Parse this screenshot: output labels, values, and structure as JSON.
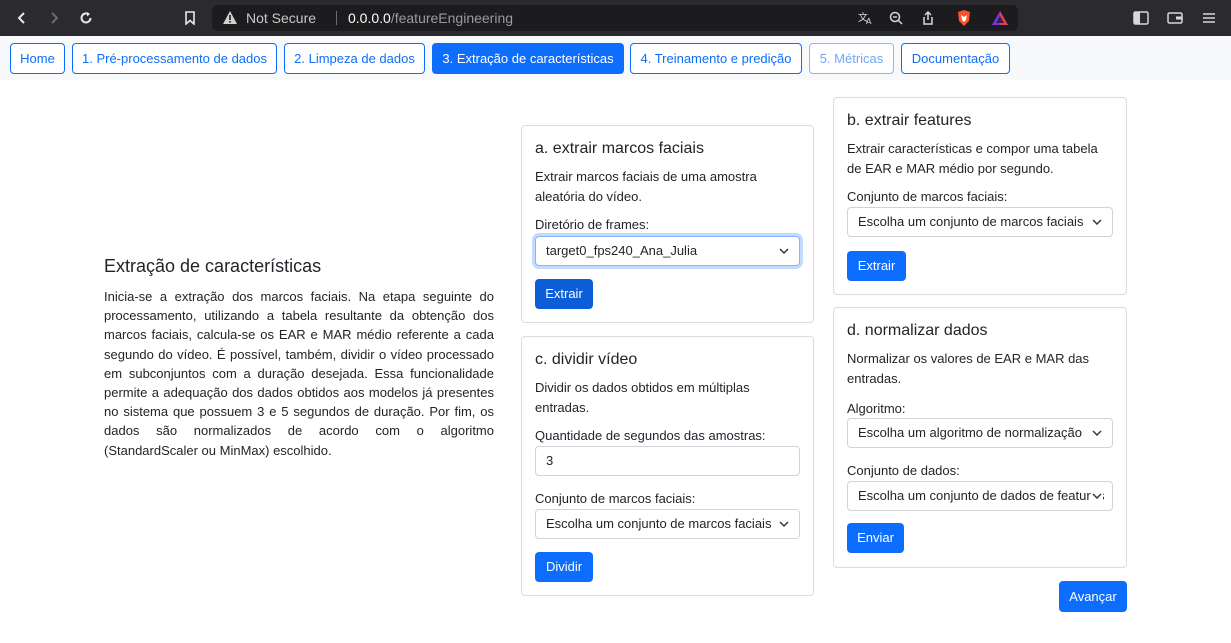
{
  "browser": {
    "security_label": "Not Secure",
    "url_host": "0.0.0.0",
    "url_path": "/featureEngineering"
  },
  "nav": {
    "items": [
      {
        "label": "Home"
      },
      {
        "label": "1. Pré-processamento de dados"
      },
      {
        "label": "2. Limpeza de dados"
      },
      {
        "label": "3. Extração de características"
      },
      {
        "label": "4. Treinamento e predição"
      },
      {
        "label": "5. Métricas"
      },
      {
        "label": "Documentação"
      }
    ],
    "active_index": 3,
    "disabled_index": 5
  },
  "intro": {
    "title": "Extração de características",
    "text": "Inicia-se a extração dos marcos faciais. Na etapa seguinte do processamento, utilizando a tabela resultante da obtenção dos marcos faciais, calcula-se os EAR e MAR médio referente a cada segundo do vídeo. É possível, também, dividir o vídeo processado em subconjuntos com a duração desejada. Essa funcionalidade permite a adequação dos dados obtidos aos modelos já presentes no sistema que possuem 3 e 5 segundos de duração. Por fim, os dados são normalizados de acordo com o algoritmo (StandardScaler ou MinMax) escolhido."
  },
  "card_a": {
    "title": "a. extrair marcos faciais",
    "desc": "Extrair marcos faciais de uma amostra aleatória do vídeo.",
    "field_label": "Diretório de frames:",
    "select_value": "target0_fps240_Ana_Julia",
    "button": "Extrair"
  },
  "card_b": {
    "title": "b. extrair features",
    "desc": "Extrair características e compor uma tabela de EAR e MAR médio por segundo.",
    "field_label": "Conjunto de marcos faciais:",
    "select_value": "Escolha um conjunto de marcos faciais",
    "button": "Extrair"
  },
  "card_c": {
    "title": "c. dividir vídeo",
    "desc": "Dividir os dados obtidos em múltiplas entradas.",
    "seconds_label": "Quantidade de segundos das amostras:",
    "seconds_value": "3",
    "field_label": "Conjunto de marcos faciais:",
    "select_value": "Escolha um conjunto de marcos faciais",
    "button": "Dividir"
  },
  "card_d": {
    "title": "d. normalizar dados",
    "desc": "Normalizar os valores de EAR e MAR das entradas.",
    "algo_label": "Algoritmo:",
    "algo_value": "Escolha um algoritmo de normalização",
    "data_label": "Conjunto de dados:",
    "data_value": "Escolha um conjunto de dados de features",
    "button": "Enviar"
  },
  "advance_button": "Avançar",
  "colors": {
    "primary": "#0d6efd",
    "chrome": "#2b2b2f",
    "navbar": "#f8f9fa"
  }
}
